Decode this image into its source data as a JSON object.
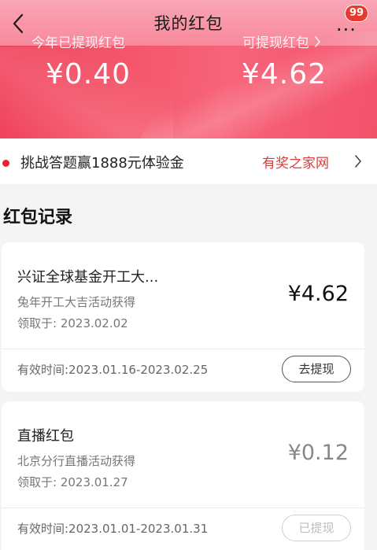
{
  "header": {
    "title": "我的红包",
    "badge_count": "99",
    "more_label": "···"
  },
  "stats": {
    "withdrawn_label": "今年已提现红包",
    "withdrawn_value": "¥0.40",
    "available_label": "可提现红包",
    "available_value": "¥4.62"
  },
  "notice": {
    "text": "挑战答题赢1888元体验金",
    "brand": "有奖之家网"
  },
  "section": {
    "title": "红包记录"
  },
  "records": [
    {
      "name": "兴证全球基金开工大...",
      "source": "兔年开工大吉活动获得",
      "date": "领取于: 2023.02.02",
      "amount": "¥4.62",
      "valid": "有效时间:2023.01.16-2023.02.25",
      "action": "去提现"
    },
    {
      "name": "直播红包",
      "source": "北京分行直播活动获得",
      "date": "领取于: 2023.01.27",
      "amount": "¥0.12",
      "valid": "有效时间:2023.01.01-2023.01.31",
      "action": "已提现"
    }
  ],
  "colors": {
    "accent": "#f0405a",
    "brand_red": "#e03a3a",
    "badge": "#e9392f"
  }
}
